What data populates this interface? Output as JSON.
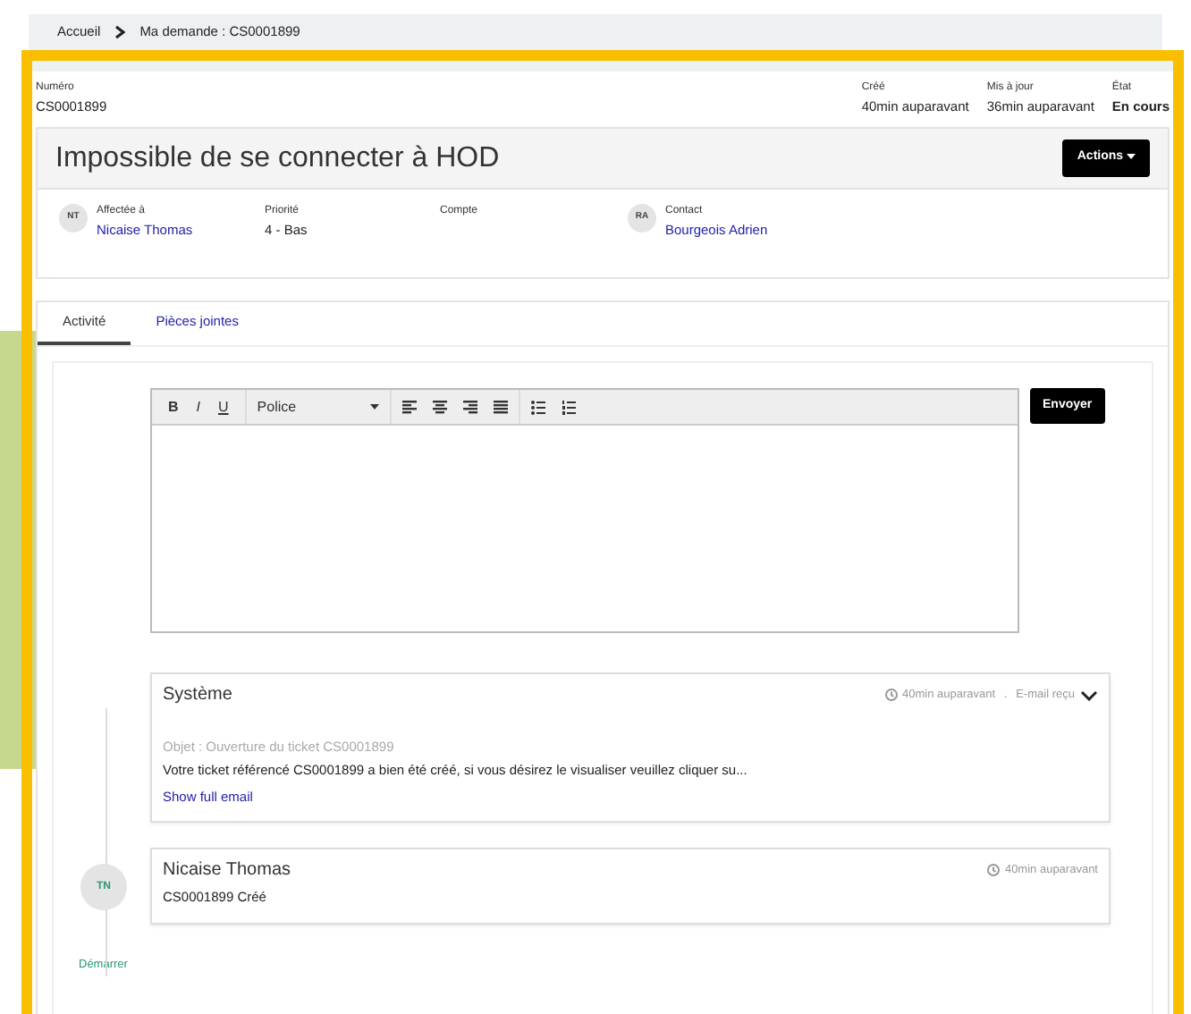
{
  "breadcrumb": [
    "Accueil",
    "Ma demande : CS0001899"
  ],
  "header": {
    "number": {
      "label": "Numéro",
      "value": "CS0001899"
    },
    "meta": [
      {
        "label": "Créé",
        "value": "40min auparavant",
        "kind": "time"
      },
      {
        "label": "Mis à jour",
        "value": "36min auparavant",
        "kind": "time"
      },
      {
        "label": "État",
        "value": "En cours",
        "kind": "status"
      }
    ]
  },
  "title": "Impossible de se connecter à HOD",
  "actions_button": "Actions",
  "fields": [
    {
      "initials": "NT",
      "label": "Affectée à",
      "value": "Nicaise Thomas",
      "kind": "link"
    },
    {
      "label": "Priorité",
      "value": "4 - Bas",
      "kind": "text"
    },
    {
      "label": "Compte"
    },
    {
      "initials": "RA",
      "label": "Contact",
      "value": "Bourgeois Adrien",
      "kind": "link"
    }
  ],
  "tabs": [
    {
      "label": "Activité",
      "selected": true
    },
    {
      "label": "Pièces jointes",
      "selected": false
    }
  ],
  "editor": {
    "format_buttons": [
      "B",
      "I",
      "U"
    ],
    "font": "Police",
    "send_button": "Envoyer"
  },
  "timeline": [
    {
      "kind": "email",
      "author": "Système",
      "time": "40min auparavant",
      "separator": ".",
      "type_label": "E-mail reçu",
      "subject": "Objet : Ouverture du ticket CS0001899",
      "body": "Votre ticket référencé CS0001899 a bien été créé, si vous désirez le visualiser veuillez cliquer su...",
      "link": "Show full email"
    },
    {
      "kind": "note",
      "initials": "TN",
      "author": "Nicaise Thomas",
      "time": "40min auparavant",
      "body": "CS0001899 Créé"
    }
  ],
  "start_label": "Démarrer"
}
